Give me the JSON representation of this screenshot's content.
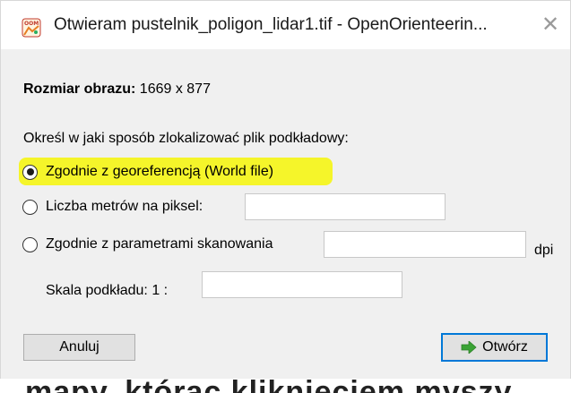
{
  "window": {
    "title": "Otwieram pustelnik_poligon_lidar1.tif - OpenOrienteerin...",
    "app_icon": "oom-app-icon",
    "close_icon": "close-icon"
  },
  "info": {
    "size_label": "Rozmiar obrazu:",
    "size_value": "1669 x 877"
  },
  "question": "Określ w jaki sposób zlokalizować plik podkładowy:",
  "options": [
    {
      "label": "Zgodnie z georeferencją (World file)",
      "checked": true
    },
    {
      "label": "Liczba metrów na piksel:",
      "checked": false,
      "value": ""
    },
    {
      "label": "Zgodnie z parametrami skanowania",
      "checked": false,
      "value": "",
      "unit": "dpi"
    }
  ],
  "scale": {
    "label": "Skala podkładu:",
    "prefix": "1 :",
    "value": ""
  },
  "buttons": {
    "cancel": "Anuluj",
    "open": "Otwórz"
  },
  "background_text": "mapy, którąc kliknięciem myszy",
  "colors": {
    "highlight": "#f5f52a",
    "accent": "#0078d7",
    "arrow": "#3aa335"
  }
}
